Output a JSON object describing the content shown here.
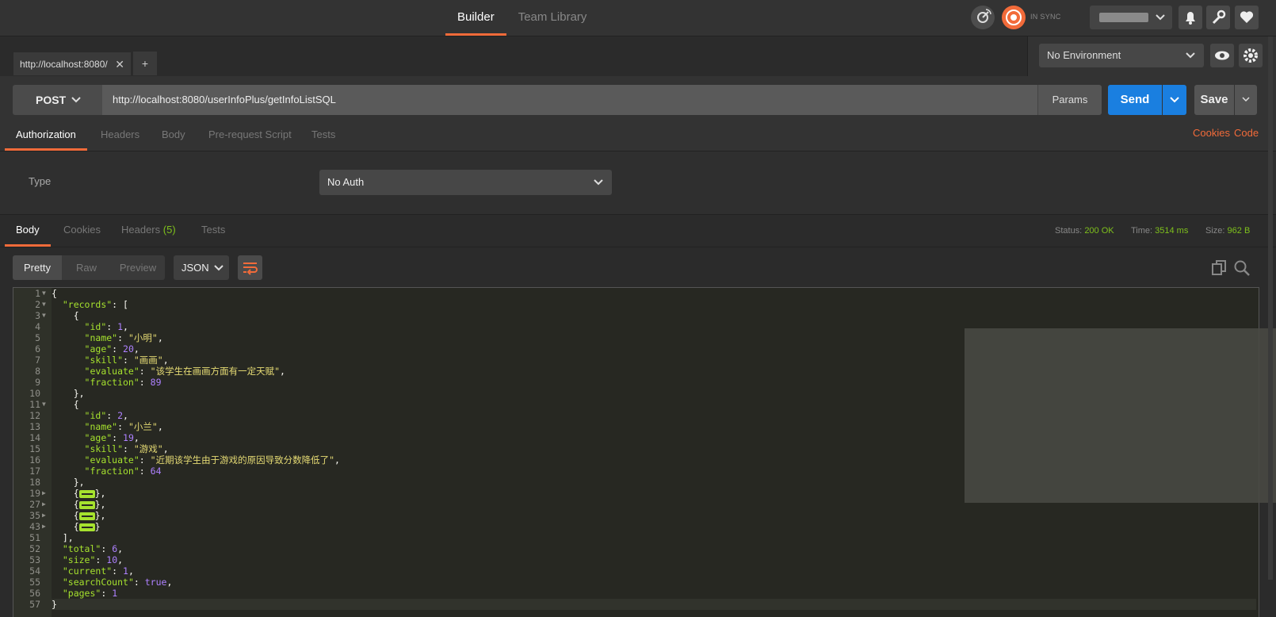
{
  "header": {
    "nav": [
      {
        "label": "Builder",
        "active": true
      },
      {
        "label": "Team Library",
        "active": false
      }
    ],
    "sync_status": "IN SYNC",
    "icons": [
      "satellite-icon",
      "sync-icon",
      "bell-icon",
      "wrench-icon",
      "heart-icon"
    ]
  },
  "tabs": {
    "request_tab_label": "http://localhost:8080/",
    "close_symbol": "✕",
    "add_symbol": "+"
  },
  "environment": {
    "selected": "No Environment"
  },
  "request": {
    "method": "POST",
    "url": "http://localhost:8080/userInfoPlus/getInfoListSQL",
    "params_label": "Params",
    "send_label": "Send",
    "save_label": "Save"
  },
  "request_tabs": [
    {
      "label": "Authorization",
      "active": true
    },
    {
      "label": "Headers",
      "active": false
    },
    {
      "label": "Body",
      "active": false
    },
    {
      "label": "Pre-request Script",
      "active": false
    },
    {
      "label": "Tests",
      "active": false
    }
  ],
  "links": {
    "cookies": "Cookies",
    "code": "Code"
  },
  "auth": {
    "type_label": "Type",
    "selected": "No Auth"
  },
  "response_tabs": [
    {
      "label": "Body",
      "active": true
    },
    {
      "label": "Cookies",
      "active": false
    },
    {
      "label": "Headers",
      "count": "(5)",
      "active": false
    },
    {
      "label": "Tests",
      "active": false
    }
  ],
  "response_stats": {
    "status_label": "Status:",
    "status_value": "200 OK",
    "time_label": "Time:",
    "time_value": "3514 ms",
    "size_label": "Size:",
    "size_value": "962 B"
  },
  "view": {
    "modes": [
      "Pretty",
      "Raw",
      "Preview"
    ],
    "active_mode": "Pretty",
    "format": "JSON"
  },
  "colors": {
    "accent": "#f26b3a",
    "send": "#1a7fe0",
    "success": "#7ec01c"
  },
  "code_lines": [
    {
      "n": "1",
      "fold": "open",
      "tokens": [
        [
          "p",
          "{"
        ]
      ]
    },
    {
      "n": "2",
      "fold": "open",
      "tokens": [
        [
          "p",
          "  "
        ],
        [
          "k",
          "\"records\""
        ],
        [
          "p",
          ": ["
        ]
      ]
    },
    {
      "n": "3",
      "fold": "open",
      "tokens": [
        [
          "p",
          "    {"
        ]
      ]
    },
    {
      "n": "4",
      "tokens": [
        [
          "p",
          "      "
        ],
        [
          "k",
          "\"id\""
        ],
        [
          "p",
          ": "
        ],
        [
          "n",
          "1"
        ],
        [
          "p",
          ","
        ]
      ]
    },
    {
      "n": "5",
      "tokens": [
        [
          "p",
          "      "
        ],
        [
          "k",
          "\"name\""
        ],
        [
          "p",
          ": "
        ],
        [
          "s",
          "\"小明\""
        ],
        [
          "p",
          ","
        ]
      ]
    },
    {
      "n": "6",
      "tokens": [
        [
          "p",
          "      "
        ],
        [
          "k",
          "\"age\""
        ],
        [
          "p",
          ": "
        ],
        [
          "n",
          "20"
        ],
        [
          "p",
          ","
        ]
      ]
    },
    {
      "n": "7",
      "tokens": [
        [
          "p",
          "      "
        ],
        [
          "k",
          "\"skill\""
        ],
        [
          "p",
          ": "
        ],
        [
          "s",
          "\"画画\""
        ],
        [
          "p",
          ","
        ]
      ]
    },
    {
      "n": "8",
      "tokens": [
        [
          "p",
          "      "
        ],
        [
          "k",
          "\"evaluate\""
        ],
        [
          "p",
          ": "
        ],
        [
          "s",
          "\"该学生在画画方面有一定天赋\""
        ],
        [
          "p",
          ","
        ]
      ]
    },
    {
      "n": "9",
      "tokens": [
        [
          "p",
          "      "
        ],
        [
          "k",
          "\"fraction\""
        ],
        [
          "p",
          ": "
        ],
        [
          "n",
          "89"
        ]
      ]
    },
    {
      "n": "10",
      "tokens": [
        [
          "p",
          "    },"
        ]
      ]
    },
    {
      "n": "11",
      "fold": "open",
      "tokens": [
        [
          "p",
          "    {"
        ]
      ]
    },
    {
      "n": "12",
      "tokens": [
        [
          "p",
          "      "
        ],
        [
          "k",
          "\"id\""
        ],
        [
          "p",
          ": "
        ],
        [
          "n",
          "2"
        ],
        [
          "p",
          ","
        ]
      ]
    },
    {
      "n": "13",
      "tokens": [
        [
          "p",
          "      "
        ],
        [
          "k",
          "\"name\""
        ],
        [
          "p",
          ": "
        ],
        [
          "s",
          "\"小兰\""
        ],
        [
          "p",
          ","
        ]
      ]
    },
    {
      "n": "14",
      "tokens": [
        [
          "p",
          "      "
        ],
        [
          "k",
          "\"age\""
        ],
        [
          "p",
          ": "
        ],
        [
          "n",
          "19"
        ],
        [
          "p",
          ","
        ]
      ]
    },
    {
      "n": "15",
      "tokens": [
        [
          "p",
          "      "
        ],
        [
          "k",
          "\"skill\""
        ],
        [
          "p",
          ": "
        ],
        [
          "s",
          "\"游戏\""
        ],
        [
          "p",
          ","
        ]
      ]
    },
    {
      "n": "16",
      "tokens": [
        [
          "p",
          "      "
        ],
        [
          "k",
          "\"evaluate\""
        ],
        [
          "p",
          ": "
        ],
        [
          "s",
          "\"近期该学生由于游戏的原因导致分数降低了\""
        ],
        [
          "p",
          ","
        ]
      ]
    },
    {
      "n": "17",
      "tokens": [
        [
          "p",
          "      "
        ],
        [
          "k",
          "\"fraction\""
        ],
        [
          "p",
          ": "
        ],
        [
          "n",
          "64"
        ]
      ]
    },
    {
      "n": "18",
      "tokens": [
        [
          "p",
          "    },"
        ]
      ]
    },
    {
      "n": "19",
      "fold": "closed",
      "tokens": [
        [
          "p",
          "    {"
        ],
        [
          "c",
          ""
        ],
        [
          "p",
          "},"
        ]
      ]
    },
    {
      "n": "27",
      "fold": "closed",
      "tokens": [
        [
          "p",
          "    {"
        ],
        [
          "c",
          ""
        ],
        [
          "p",
          "},"
        ]
      ]
    },
    {
      "n": "35",
      "fold": "closed",
      "tokens": [
        [
          "p",
          "    {"
        ],
        [
          "c",
          ""
        ],
        [
          "p",
          "},"
        ]
      ]
    },
    {
      "n": "43",
      "fold": "closed",
      "tokens": [
        [
          "p",
          "    {"
        ],
        [
          "c",
          ""
        ],
        [
          "p",
          "}"
        ]
      ]
    },
    {
      "n": "51",
      "tokens": [
        [
          "p",
          "  ],"
        ]
      ]
    },
    {
      "n": "52",
      "tokens": [
        [
          "p",
          "  "
        ],
        [
          "k",
          "\"total\""
        ],
        [
          "p",
          ": "
        ],
        [
          "n",
          "6"
        ],
        [
          "p",
          ","
        ]
      ]
    },
    {
      "n": "53",
      "tokens": [
        [
          "p",
          "  "
        ],
        [
          "k",
          "\"size\""
        ],
        [
          "p",
          ": "
        ],
        [
          "n",
          "10"
        ],
        [
          "p",
          ","
        ]
      ]
    },
    {
      "n": "54",
      "tokens": [
        [
          "p",
          "  "
        ],
        [
          "k",
          "\"current\""
        ],
        [
          "p",
          ": "
        ],
        [
          "n",
          "1"
        ],
        [
          "p",
          ","
        ]
      ]
    },
    {
      "n": "55",
      "tokens": [
        [
          "p",
          "  "
        ],
        [
          "k",
          "\"searchCount\""
        ],
        [
          "p",
          ": "
        ],
        [
          "b",
          "true"
        ],
        [
          "p",
          ","
        ]
      ]
    },
    {
      "n": "56",
      "tokens": [
        [
          "p",
          "  "
        ],
        [
          "k",
          "\"pages\""
        ],
        [
          "p",
          ": "
        ],
        [
          "n",
          "1"
        ]
      ]
    },
    {
      "n": "57",
      "cur": true,
      "tokens": [
        [
          "p",
          "}"
        ]
      ]
    }
  ]
}
